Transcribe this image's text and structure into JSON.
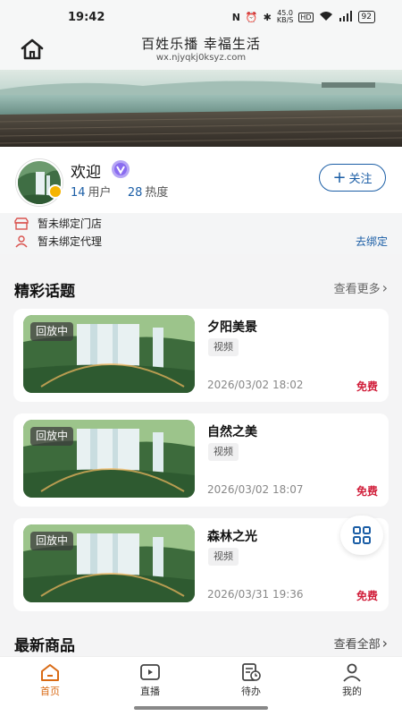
{
  "statusbar": {
    "time": "19:42",
    "speed": "45.0",
    "speed_unit": "KB/S",
    "battery": "92"
  },
  "header": {
    "title": "百姓乐播 幸福生活",
    "subtitle": "wx.njyqkj0ksyz.com"
  },
  "profile": {
    "welcome": "欢迎",
    "users_count": "14",
    "users_label": "用户",
    "heat_count": "28",
    "heat_label": "热度",
    "follow_label": "关注"
  },
  "binding": {
    "store": "暂未绑定门店",
    "agent": "暂未绑定代理",
    "bind_link": "去绑定"
  },
  "topics": {
    "title": "精彩话题",
    "more": "查看更多",
    "items": [
      {
        "status": "回放中",
        "title": "夕阳美景",
        "tag": "视频",
        "time": "2026/03/02 18:02",
        "price": "免费"
      },
      {
        "status": "回放中",
        "title": "自然之美",
        "tag": "视频",
        "time": "2026/03/02 18:07",
        "price": "免费"
      },
      {
        "status": "回放中",
        "title": "森林之光",
        "tag": "视频",
        "time": "2026/03/31 19:36",
        "price": "免费"
      }
    ]
  },
  "products": {
    "title": "最新商品",
    "more": "查看全部"
  },
  "nav": {
    "items": [
      {
        "label": "首页",
        "icon": "home-icon"
      },
      {
        "label": "直播",
        "icon": "live-icon"
      },
      {
        "label": "待办",
        "icon": "todo-icon"
      },
      {
        "label": "我的",
        "icon": "profile-icon"
      }
    ]
  },
  "colors": {
    "accent": "#1b5ea6",
    "active_nav": "#d96a14",
    "free": "#d11f3b"
  }
}
